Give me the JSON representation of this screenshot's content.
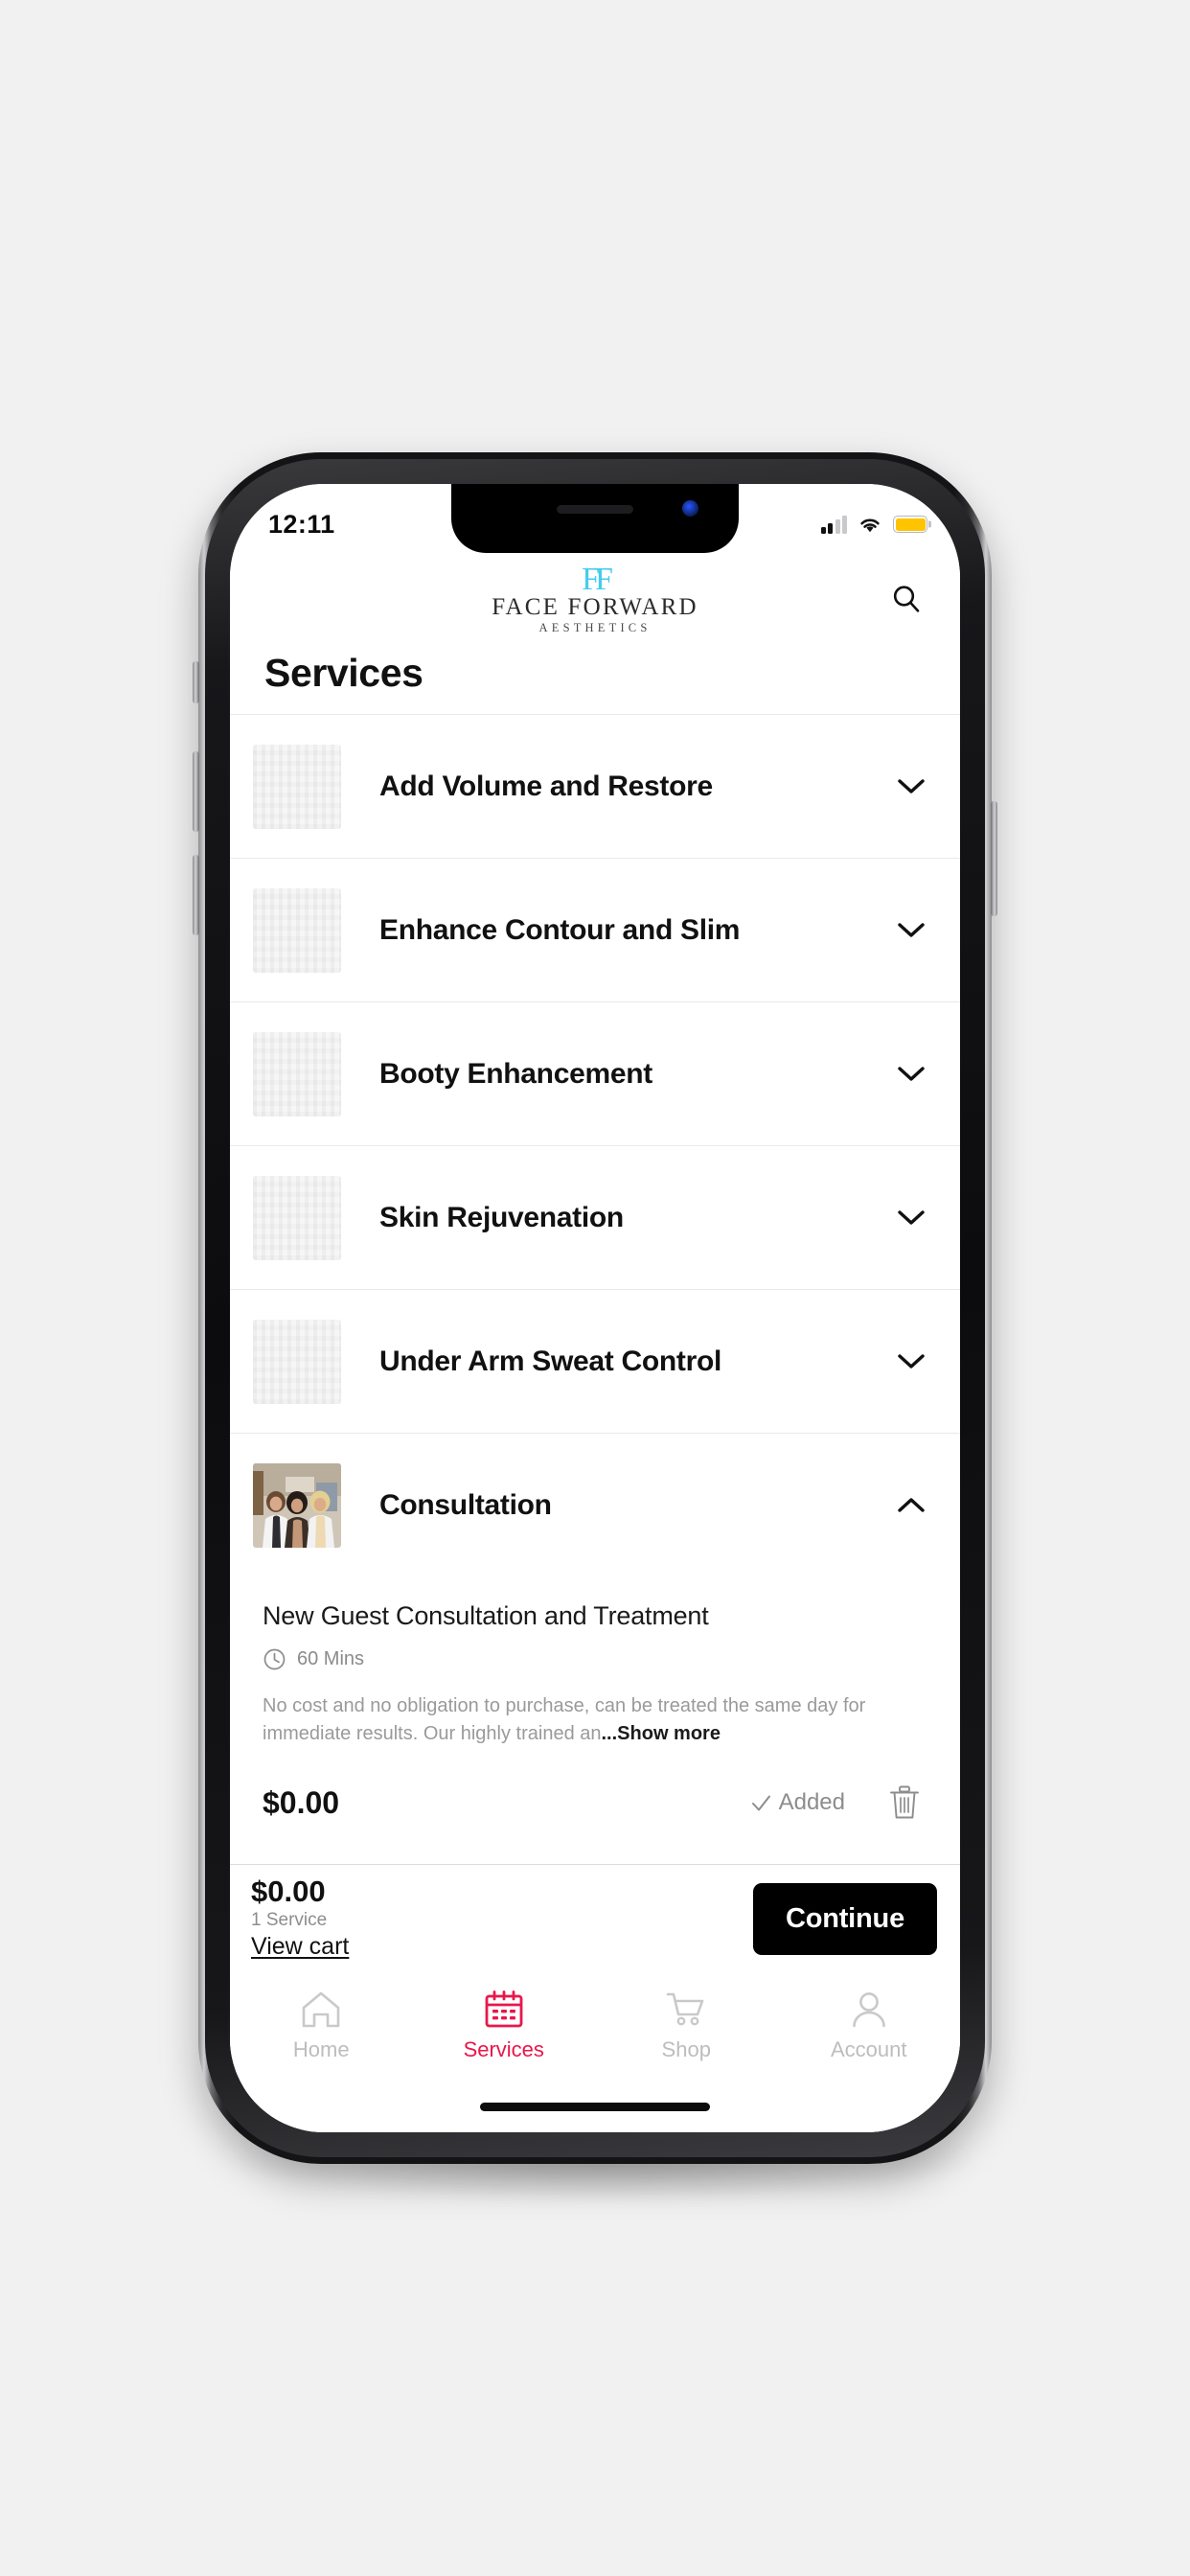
{
  "status_bar": {
    "time": "12:11",
    "signal_icon": "cellular-signal-icon",
    "wifi_icon": "wifi-icon",
    "battery_icon": "battery-icon",
    "battery_color": "#FFC400"
  },
  "header": {
    "brand_monogram": "FF",
    "brand_line1": "FACE FORWARD",
    "brand_line2": "AESTHETICS",
    "brand_accent_color": "#43CDEC",
    "search_icon": "search-icon"
  },
  "page": {
    "title": "Services"
  },
  "services": [
    {
      "name": "Add Volume and Restore",
      "expanded": false,
      "chevron": "chevron-down-icon",
      "thumb": "placeholder"
    },
    {
      "name": "Enhance Contour and Slim",
      "expanded": false,
      "chevron": "chevron-down-icon",
      "thumb": "placeholder"
    },
    {
      "name": "Booty Enhancement",
      "expanded": false,
      "chevron": "chevron-down-icon",
      "thumb": "placeholder"
    },
    {
      "name": "Skin Rejuvenation",
      "expanded": false,
      "chevron": "chevron-down-icon",
      "thumb": "placeholder"
    },
    {
      "name": "Under Arm Sweat Control",
      "expanded": false,
      "chevron": "chevron-down-icon",
      "thumb": "placeholder"
    },
    {
      "name": "Consultation",
      "expanded": true,
      "chevron": "chevron-up-icon",
      "thumb": "staff-photo"
    }
  ],
  "detail": {
    "title": "New Guest Consultation and Treatment",
    "clock_icon": "clock-icon",
    "duration": "60 Mins",
    "description": "No cost and no obligation to purchase, can be treated the same day for immediate results. Our highly trained an",
    "show_more": "...Show more",
    "price": "$0.00",
    "added_label": "Added",
    "check_icon": "check-icon",
    "trash_icon": "trash-icon"
  },
  "cart": {
    "total": "$0.00",
    "count": "1 Service",
    "view_cart": "View cart",
    "continue": "Continue"
  },
  "tabs": [
    {
      "label": "Home",
      "icon": "home-icon",
      "active": false
    },
    {
      "label": "Services",
      "icon": "calendar-icon",
      "active": true
    },
    {
      "label": "Shop",
      "icon": "cart-icon",
      "active": false
    },
    {
      "label": "Account",
      "icon": "person-icon",
      "active": false
    }
  ],
  "theme": {
    "accent": "#E8174B",
    "brand_cyan": "#43CDEC",
    "button_black": "#000000"
  }
}
